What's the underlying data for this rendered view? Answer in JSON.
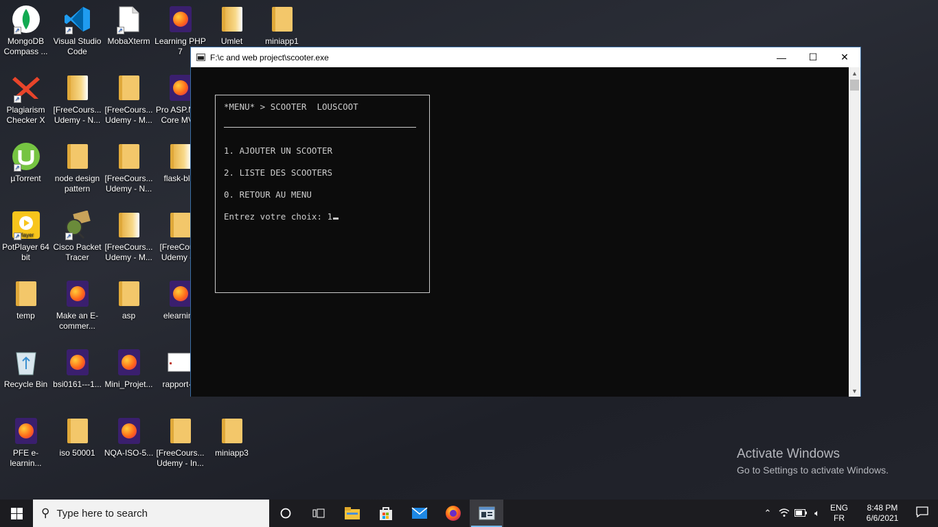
{
  "desktop": {
    "icons": [
      {
        "label": "MongoDB Compass ...",
        "icon": "mongodb-compass-icon"
      },
      {
        "label": "Visual Studio Code",
        "icon": "vscode-icon"
      },
      {
        "label": "MobaXterm",
        "icon": "file-icon"
      },
      {
        "label": "Learning PHP 7",
        "icon": "firefox-pdf-icon"
      },
      {
        "label": "Umlet",
        "icon": "folder-icon"
      },
      {
        "label": "miniapp1",
        "icon": "folder-icon"
      },
      {
        "label": "Plagiarism Checker X",
        "icon": "plagiarism-checker-icon"
      },
      {
        "label": "[FreeCours... Udemy - N...",
        "icon": "folder-icon"
      },
      {
        "label": "[FreeCours... Udemy - M...",
        "icon": "folder-icon"
      },
      {
        "label": "Pro ASP.NET Core MVC",
        "icon": "firefox-pdf-icon"
      },
      {
        "label": "µTorrent",
        "icon": "utorrent-icon"
      },
      {
        "label": "node design pattern",
        "icon": "folder-icon"
      },
      {
        "label": "[FreeCours... Udemy - N...",
        "icon": "folder-icon"
      },
      {
        "label": "flask-bl...",
        "icon": "folder-icon"
      },
      {
        "label": "PotPlayer 64 bit",
        "icon": "potplayer-icon"
      },
      {
        "label": "Cisco Packet Tracer",
        "icon": "cisco-packet-tracer-icon"
      },
      {
        "label": "[FreeCours... Udemy - M...",
        "icon": "folder-icon"
      },
      {
        "label": "[FreeCou... Udemy -...",
        "icon": "folder-icon"
      },
      {
        "label": "temp",
        "icon": "folder-icon"
      },
      {
        "label": "Make an E-commer...",
        "icon": "firefox-pdf-icon"
      },
      {
        "label": "asp",
        "icon": "folder-icon"
      },
      {
        "label": "elearning",
        "icon": "firefox-pdf-icon"
      },
      {
        "label": "Recycle Bin",
        "icon": "recycle-bin-icon"
      },
      {
        "label": "bsi0161---1...",
        "icon": "firefox-pdf-icon"
      },
      {
        "label": "Mini_Projet...",
        "icon": "firefox-pdf-icon"
      },
      {
        "label": "rapport-...",
        "icon": "document-icon"
      },
      {
        "label": "PFE e-learnin...",
        "icon": "firefox-pdf-icon"
      },
      {
        "label": "iso 50001",
        "icon": "folder-icon"
      },
      {
        "label": "NQA-ISO-5...",
        "icon": "firefox-pdf-icon"
      },
      {
        "label": "[FreeCours... Udemy - In...",
        "icon": "folder-icon"
      },
      {
        "label": "miniapp3",
        "icon": "folder-icon"
      }
    ]
  },
  "window": {
    "title": "F:\\c and web project\\scooter.exe",
    "minimize": "—",
    "maximize": "☐",
    "close": "✕"
  },
  "console": {
    "header": "*MENU* > SCOOTER  LOUSCOOT",
    "option1": "1. AJOUTER UN SCOOTER",
    "option2": "2. LISTE DES SCOOTERS",
    "option0": "0. RETOUR AU MENU",
    "prompt": "Entrez votre choix: ",
    "input": "1"
  },
  "watermark": {
    "line1": "Activate Windows",
    "line2": "Go to Settings to activate Windows."
  },
  "taskbar": {
    "search_placeholder": "Type here to search",
    "language_top": "ENG",
    "language_bottom": "FR",
    "time": "8:48 PM",
    "date": "6/6/2021"
  }
}
